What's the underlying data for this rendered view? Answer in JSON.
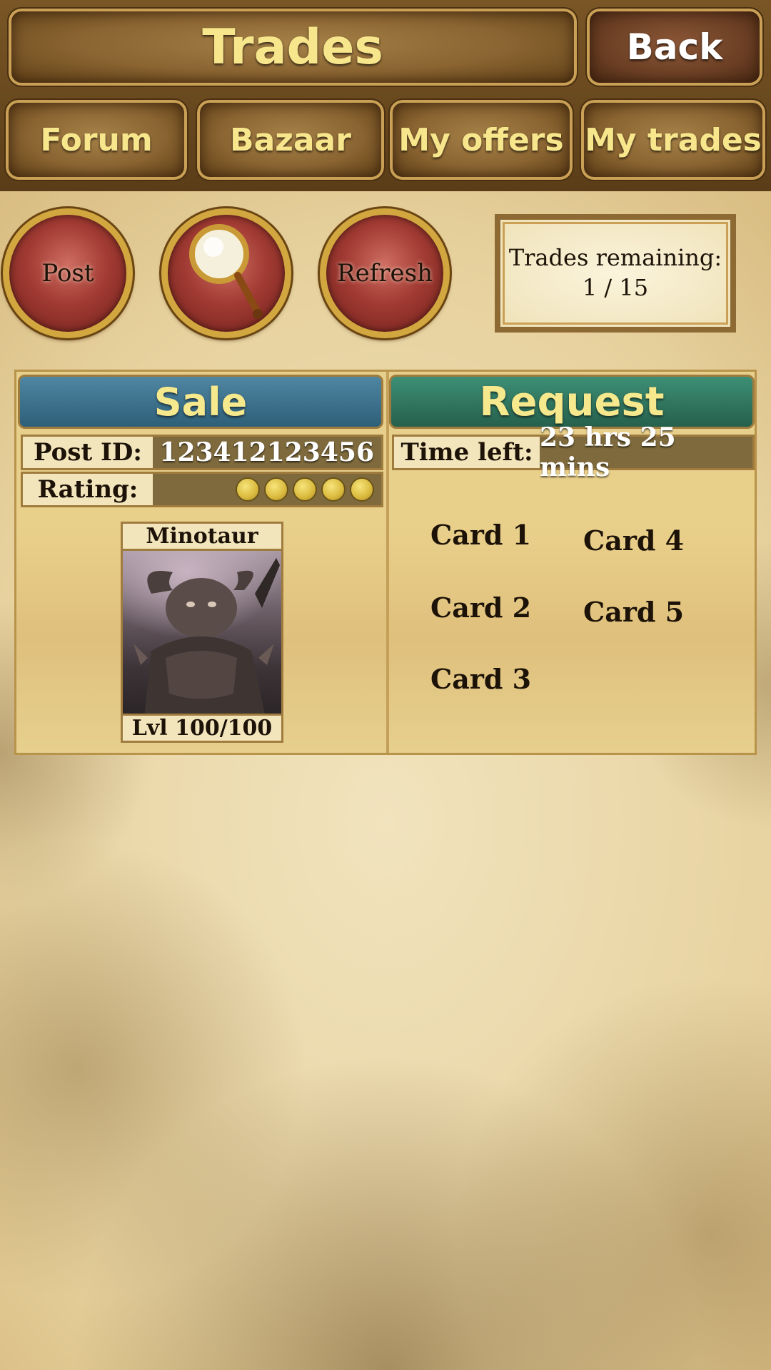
{
  "header": {
    "title": "Trades",
    "back_label": "Back"
  },
  "tabs": [
    {
      "label": "Forum"
    },
    {
      "label": "Bazaar"
    },
    {
      "label": "My offers"
    },
    {
      "label": "My trades"
    }
  ],
  "actions": {
    "post_label": "Post",
    "search_icon": "magnifying-glass-icon",
    "refresh_label": "Refresh"
  },
  "trades_remaining": {
    "label": "Trades remaining:",
    "value": "1 / 15"
  },
  "sale": {
    "header": "Sale",
    "post_id_label": "Post ID:",
    "post_id": "123412123456",
    "rating_label": "Rating:",
    "rating_icon": "coin-icon",
    "rating": 5,
    "card": {
      "name": "Minotaur",
      "level": "Lvl 100/100"
    }
  },
  "request": {
    "header": "Request",
    "time_left_label": "Time left:",
    "time_left": "23 hrs 25 mins",
    "cards": [
      "Card 1",
      "Card 2",
      "Card 3",
      "Card 4",
      "Card 5"
    ]
  },
  "colors": {
    "sale_header": "#2e5f78",
    "request_header": "#26604c",
    "tab_text": "#f7e68c",
    "round_button": "#a13b33"
  }
}
